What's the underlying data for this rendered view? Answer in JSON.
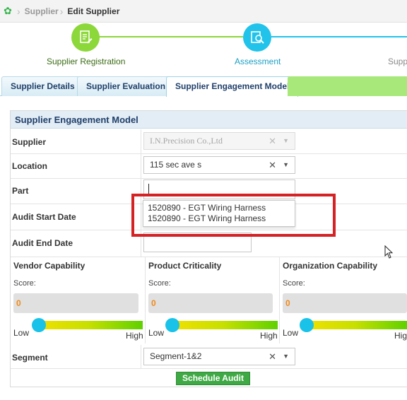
{
  "breadcrumb": {
    "home_icon": "flower-icon",
    "items": [
      "Supplier",
      "Edit Supplier"
    ]
  },
  "stepper": {
    "steps": [
      {
        "label": "Supplier Registration",
        "icon": "registration-form-icon",
        "color": "#8cd739"
      },
      {
        "label": "Assessment",
        "icon": "assessment-search-icon",
        "color": "#22c3ea"
      },
      {
        "label": "Supp",
        "icon": "",
        "color": "#22c3ea"
      }
    ]
  },
  "tabs": [
    "Supplier Details",
    "Supplier Evaluation",
    "Supplier Engagement Model"
  ],
  "panel": {
    "title": "Supplier Engagement Model",
    "fields": {
      "supplier": {
        "label": "Supplier",
        "value": "I.N.Precision Co.,Ltd"
      },
      "location": {
        "label": "Location",
        "value": "115 sec ave s"
      },
      "part": {
        "label": "Part",
        "value": ""
      },
      "audit_start": {
        "label": "Audit Start Date",
        "value": ""
      },
      "audit_end": {
        "label": "Audit End Date",
        "value": ""
      },
      "segment": {
        "label": "Segment",
        "value": "Segment-1&2"
      }
    },
    "part_dropdown": [
      "1520890 - EGT Wiring Harness",
      "1520890 - EGT Wiring Harness"
    ],
    "capabilities": [
      {
        "title": "Vendor Capability",
        "score_label": "Score:",
        "score": "0",
        "low": "Low",
        "high": "High"
      },
      {
        "title": "Product Criticality",
        "score_label": "Score:",
        "score": "0",
        "low": "Low",
        "high": "High"
      },
      {
        "title": "Organization Capability",
        "score_label": "Score:",
        "score": "0",
        "low": "Low",
        "high": "High"
      }
    ],
    "schedule_button": "Schedule Audit"
  },
  "colors": {
    "accent_green": "#35b44a",
    "accent_blue": "#22c3ea",
    "highlight_red": "#d42225",
    "score_orange": "#f08a1c"
  }
}
